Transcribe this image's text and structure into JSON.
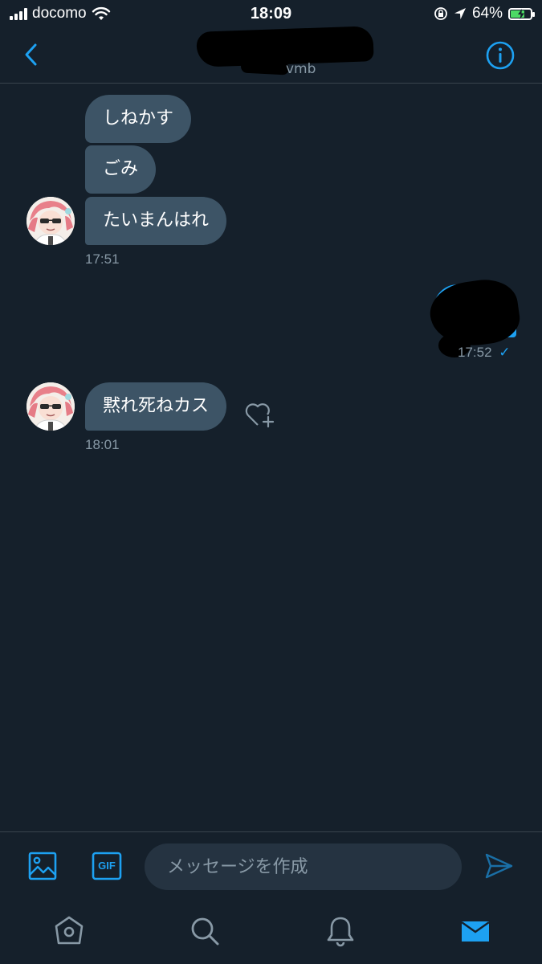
{
  "status_bar": {
    "carrier": "docomo",
    "time": "18:09",
    "battery_percent": "64%",
    "battery_level": 0.64
  },
  "header": {
    "handle_suffix": "vmb",
    "back_icon": "chevron-left-icon",
    "info_icon": "info-icon"
  },
  "messages": [
    {
      "text": "しねかす",
      "side": "received"
    },
    {
      "text": "ごみ",
      "side": "received"
    },
    {
      "text": "たいまんはれ",
      "side": "received"
    },
    {
      "time": "17:51"
    },
    {
      "time": "17:52",
      "side": "sent",
      "status": "✓"
    },
    {
      "text": "黙れ死ねカス",
      "side": "received"
    },
    {
      "time": "18:01"
    }
  ],
  "composer": {
    "placeholder": "メッセージを作成",
    "gif_label": "GIF"
  },
  "tabs": [
    "home-icon",
    "search-icon",
    "bell-icon",
    "mail-icon"
  ],
  "colors": {
    "background": "#15202b",
    "accent": "#1da1f2",
    "bubble": "#3d5466",
    "muted": "#8899a6"
  }
}
